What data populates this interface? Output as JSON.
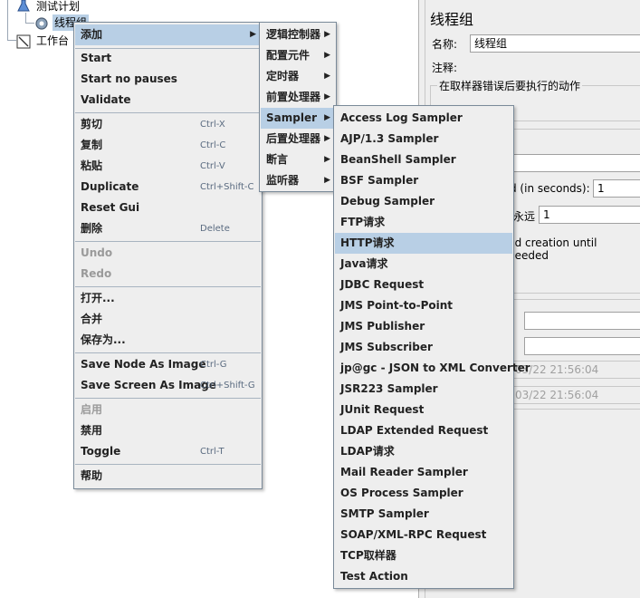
{
  "tree": {
    "root": "测试计划",
    "thread_group": "线程组",
    "workbench": "工作台"
  },
  "panel": {
    "title": "线程组",
    "name_label": "名称:",
    "name_value": "线程组",
    "comment_label": "注释:",
    "error_action_label": "在取样器错误后要执行的动作",
    "ramp_label_fragment": "d (in seconds):",
    "ramp_value": "1",
    "loop_label_fragment": "永远",
    "loop_value": "1",
    "delay_label_fragment": "nd creation until needed",
    "start_time_fragment": "03/22 21:56:04",
    "end_time_fragment": "03/22 21:56:04"
  },
  "context_menu": {
    "add": "添加",
    "start": "Start",
    "start_no_pauses": "Start no pauses",
    "validate": "Validate",
    "cut": "剪切",
    "cut_key": "Ctrl-X",
    "copy": "复制",
    "copy_key": "Ctrl-C",
    "paste": "粘贴",
    "paste_key": "Ctrl-V",
    "duplicate": "Duplicate",
    "duplicate_key": "Ctrl+Shift-C",
    "reset_gui": "Reset Gui",
    "delete": "删除",
    "delete_key": "Delete",
    "undo": "Undo",
    "redo": "Redo",
    "open": "打开...",
    "merge": "合并",
    "save_as": "保存为...",
    "save_node_image": "Save Node As Image",
    "save_node_image_key": "Ctrl-G",
    "save_screen_image": "Save Screen As Image",
    "save_screen_image_key": "Ctrl+Shift-G",
    "enable": "启用",
    "disable": "禁用",
    "toggle": "Toggle",
    "toggle_key": "Ctrl-T",
    "help": "帮助"
  },
  "add_submenu": [
    "逻辑控制器",
    "配置元件",
    "定时器",
    "前置处理器",
    "Sampler",
    "后置处理器",
    "断言",
    "监听器"
  ],
  "sampler_submenu": [
    "Access Log Sampler",
    "AJP/1.3 Sampler",
    "BeanShell Sampler",
    "BSF Sampler",
    "Debug Sampler",
    "FTP请求",
    "HTTP请求",
    "Java请求",
    "JDBC Request",
    "JMS Point-to-Point",
    "JMS Publisher",
    "JMS Subscriber",
    "jp@gc - JSON to XML Converter",
    "JSR223 Sampler",
    "JUnit Request",
    "LDAP Extended Request",
    "LDAP请求",
    "Mail Reader Sampler",
    "OS Process Sampler",
    "SMTP Sampler",
    "SOAP/XML-RPC Request",
    "TCP取样器",
    "Test Action"
  ],
  "colors": {
    "highlight": "#b8cfe5",
    "menu_bg": "#eeeeee",
    "shortcut": "#5a6b80"
  }
}
